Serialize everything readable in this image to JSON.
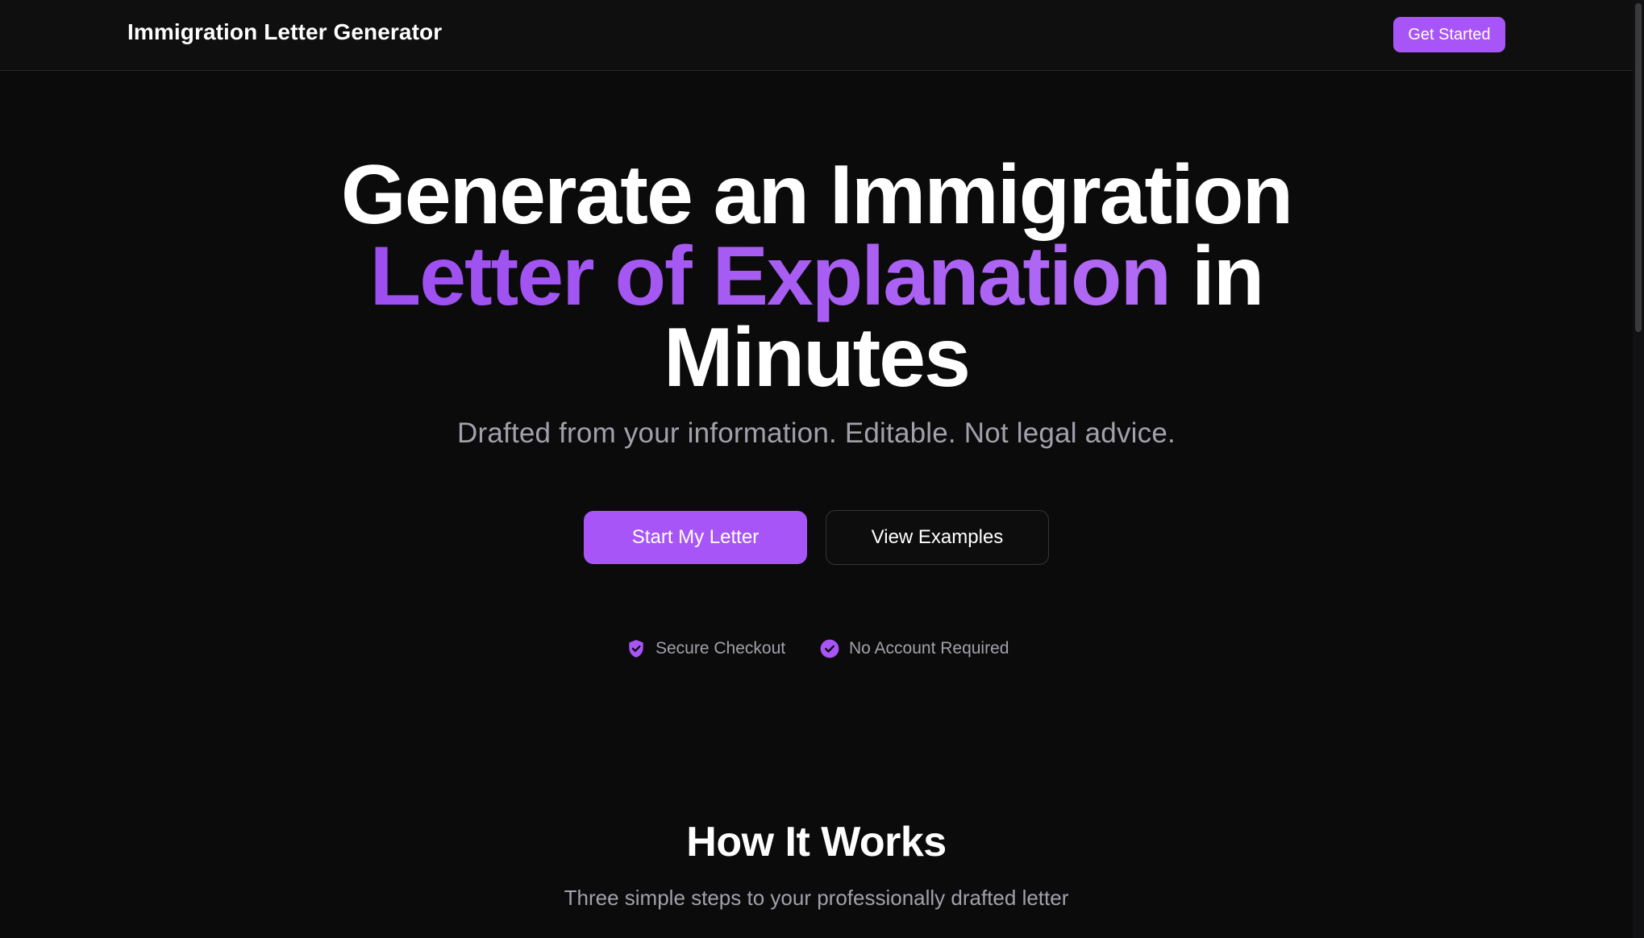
{
  "header": {
    "brand": "Immigration Letter Generator",
    "cta_label": "Get Started"
  },
  "hero": {
    "title_line1": "Generate an Immigration",
    "title_accent": "Letter of Explanation",
    "title_after_accent": " in",
    "title_line3": "Minutes",
    "subtitle": "Drafted from your information. Editable. Not legal advice.",
    "primary_button": "Start My Letter",
    "secondary_button": "View Examples",
    "trust_items": [
      {
        "label": "Secure Checkout",
        "icon": "shield-check-icon"
      },
      {
        "label": "No Account Required",
        "icon": "check-circle-icon"
      }
    ]
  },
  "how_it_works": {
    "title": "How It Works",
    "subtitle": "Three simple steps to your professionally drafted letter"
  },
  "colors": {
    "background": "#0b0b0c",
    "accent": "#a855f7",
    "muted_text": "#a1a1aa",
    "border": "#2a2a2d"
  }
}
